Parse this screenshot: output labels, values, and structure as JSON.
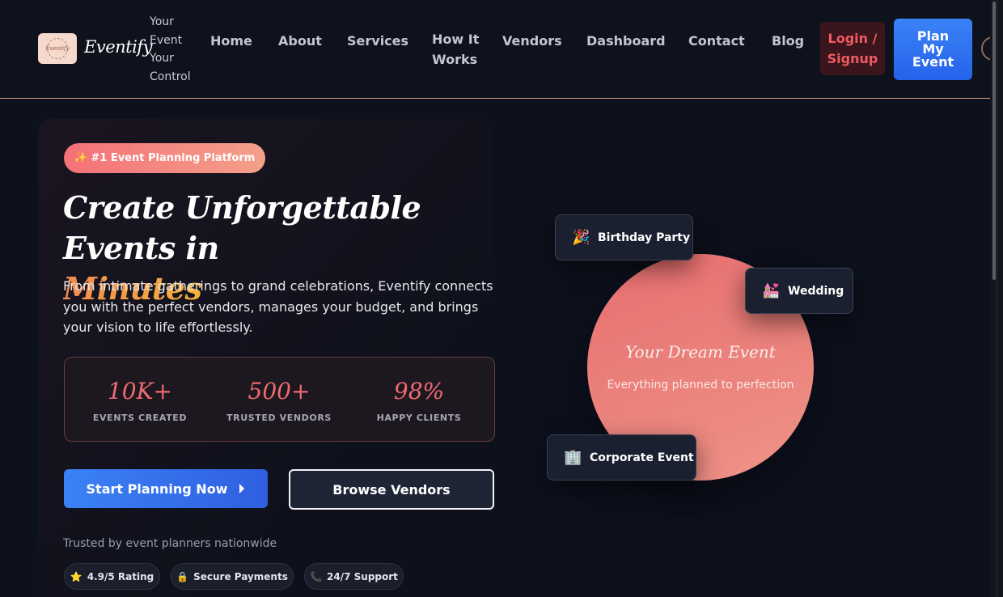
{
  "nav": {
    "logo_text": "Eventify",
    "brand": "Eventify",
    "tagline": "Your Event Your Control",
    "links": [
      "Home",
      "About",
      "Services",
      "How It Works",
      "Vendors",
      "Dashboard",
      "Contact",
      "Blog"
    ],
    "login_label": "Login / Signup",
    "plan_label": "Plan My Event"
  },
  "hero": {
    "badge": "✨ #1 Event Planning Platform",
    "headline_main": "Create Unforgettable Events in",
    "headline_accent": "Minutes",
    "description": "From intimate gatherings to grand celebrations, Eventify connects you with the perfect vendors, manages your budget, and brings your vision to life effortlessly.",
    "stats": [
      {
        "value": "10K+",
        "label": "EVENTS CREATED"
      },
      {
        "value": "500+",
        "label": "TRUSTED VENDORS"
      },
      {
        "value": "98%",
        "label": "HAPPY CLIENTS"
      }
    ],
    "start_button": "Start Planning Now",
    "browse_button": "Browse Vendors",
    "trusted_text": "Trusted by event planners nationwide",
    "pills": [
      {
        "icon": "⭐",
        "label": "4.9/5 Rating"
      },
      {
        "icon": "🔒",
        "label": "Secure Payments"
      },
      {
        "icon": "📞",
        "label": "24/7 Support"
      }
    ]
  },
  "visual": {
    "circle_title": "Your Dream Event",
    "circle_subtitle": "Everything planned to perfection",
    "cards": [
      {
        "icon": "🎉",
        "label": "Birthday Party"
      },
      {
        "icon": "💒",
        "label": "Wedding"
      },
      {
        "icon": "🏢",
        "label": "Corporate Event"
      }
    ]
  },
  "colors": {
    "accent_coral": "#ee6a70",
    "primary_blue": "#3b82f6",
    "background": "#0d111d"
  }
}
